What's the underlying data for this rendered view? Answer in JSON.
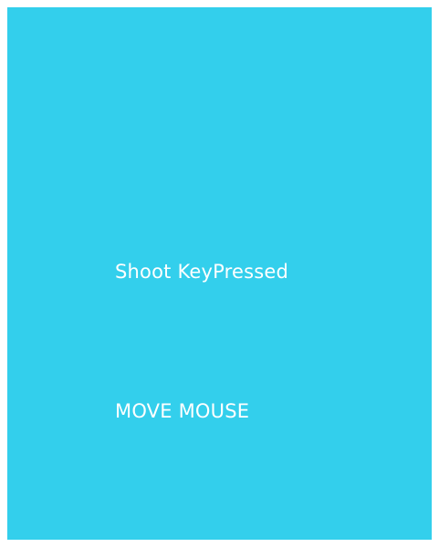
{
  "colors": {
    "stage_background": "#33cfec",
    "page_background": "#ffffff",
    "text": "#ffffff"
  },
  "stage": {
    "status_text": "Shoot KeyPressed",
    "instruction_text": "MOVE MOUSE"
  }
}
